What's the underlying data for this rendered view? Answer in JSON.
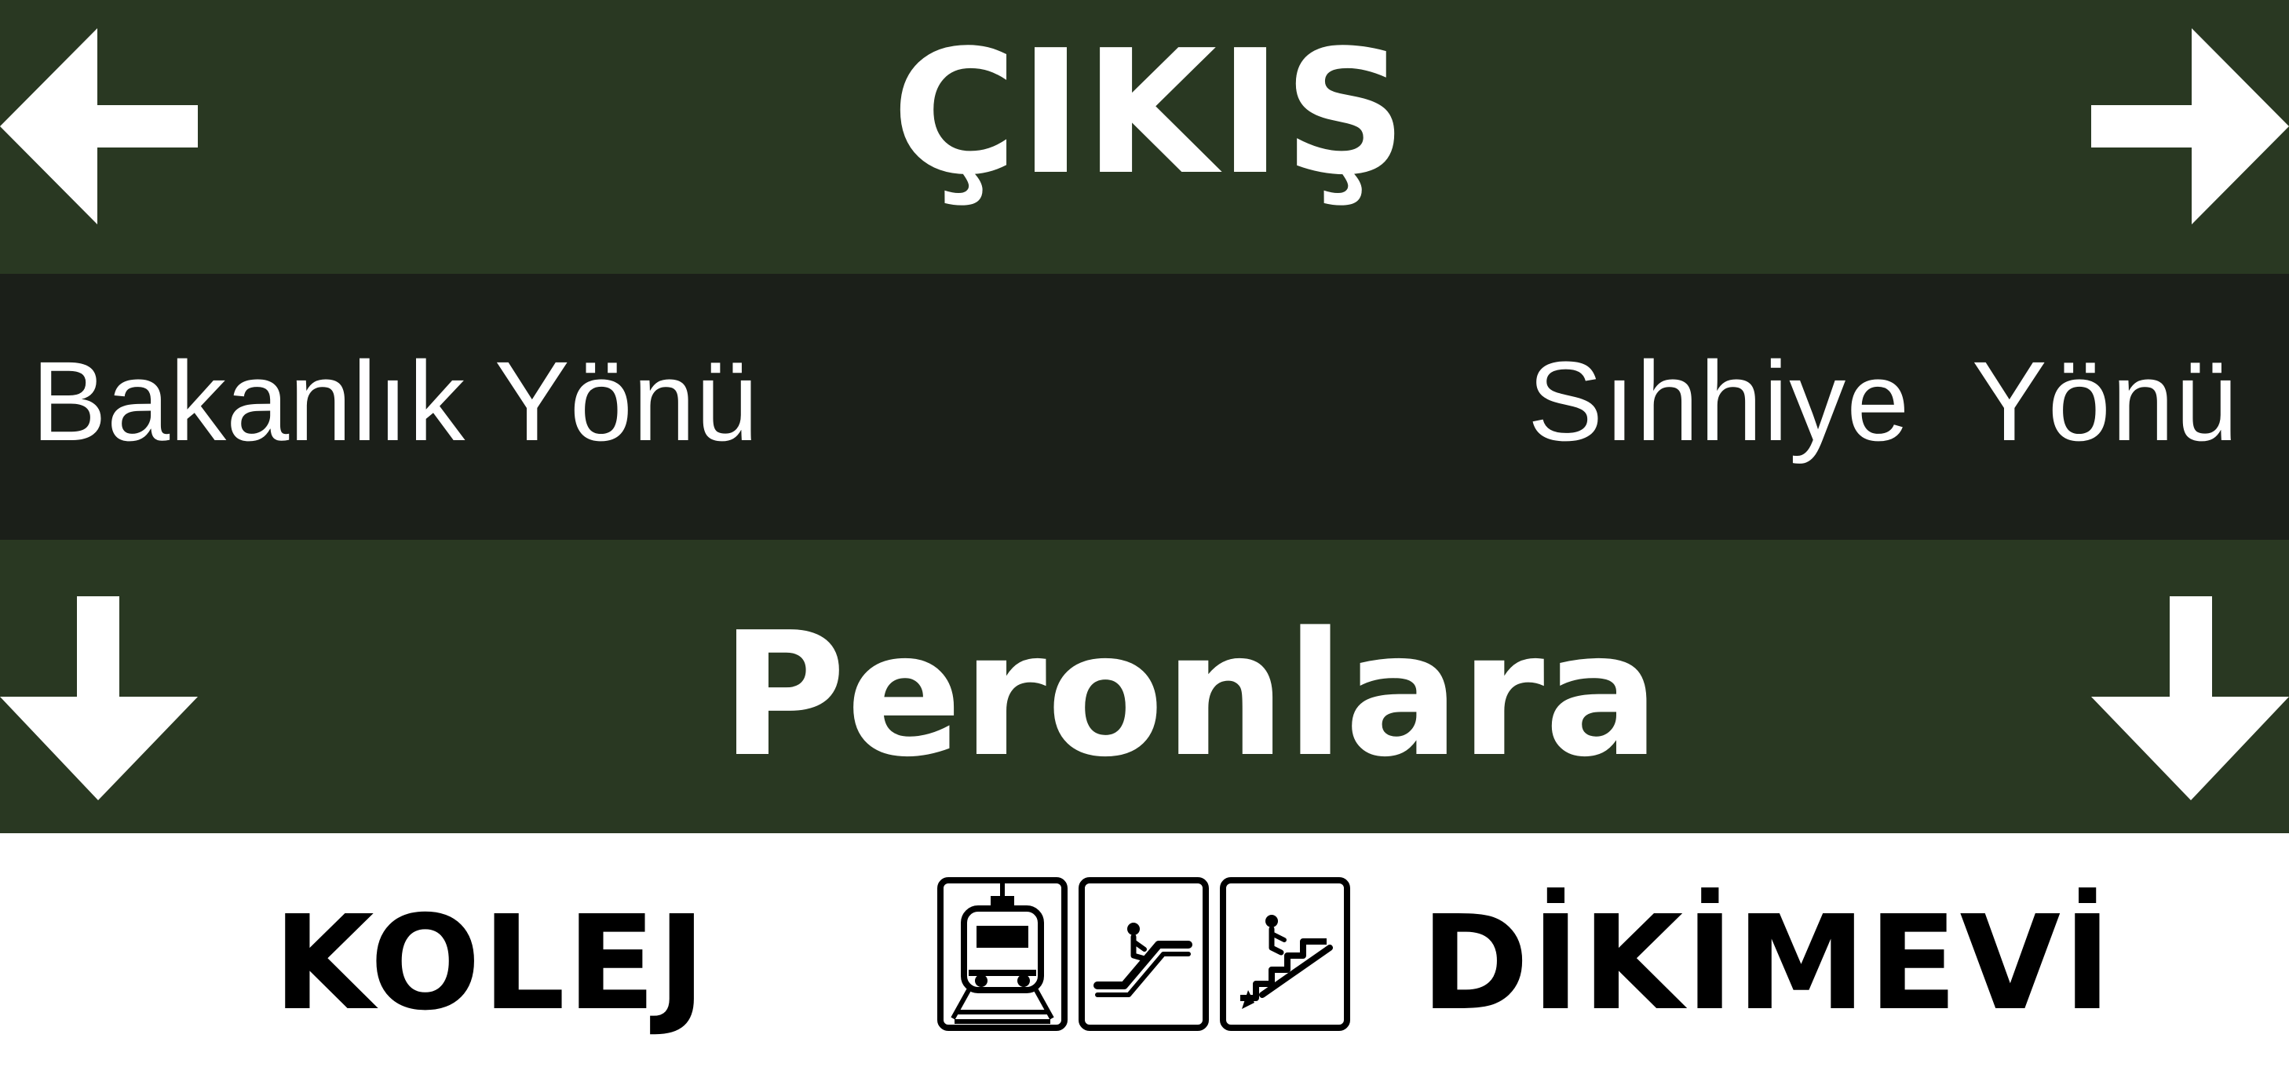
{
  "sign": {
    "exit": {
      "label": "ÇIKIŞ",
      "left_arrow_icon": "left-arrow-icon",
      "right_arrow_icon": "right-arrow-icon"
    },
    "directions": {
      "left_label": "Bakanlık Yönü",
      "right_label": "Sıhhiye Yönü"
    },
    "platforms": {
      "label": "Peronlara",
      "left_arrow_icon": "down-arrow-icon",
      "right_arrow_icon": "down-arrow-icon"
    },
    "stations": {
      "left_label": "KOLEJ",
      "right_label": "DİKİMEVİ"
    },
    "pictograms": [
      {
        "icon": "metro-train-icon"
      },
      {
        "icon": "escalator-icon"
      },
      {
        "icon": "stairs-icon"
      }
    ]
  },
  "colors": {
    "primary_green": "#293822",
    "direction_band": "#1b1f19",
    "foreground": "#ffffff",
    "station_text": "#000000"
  }
}
